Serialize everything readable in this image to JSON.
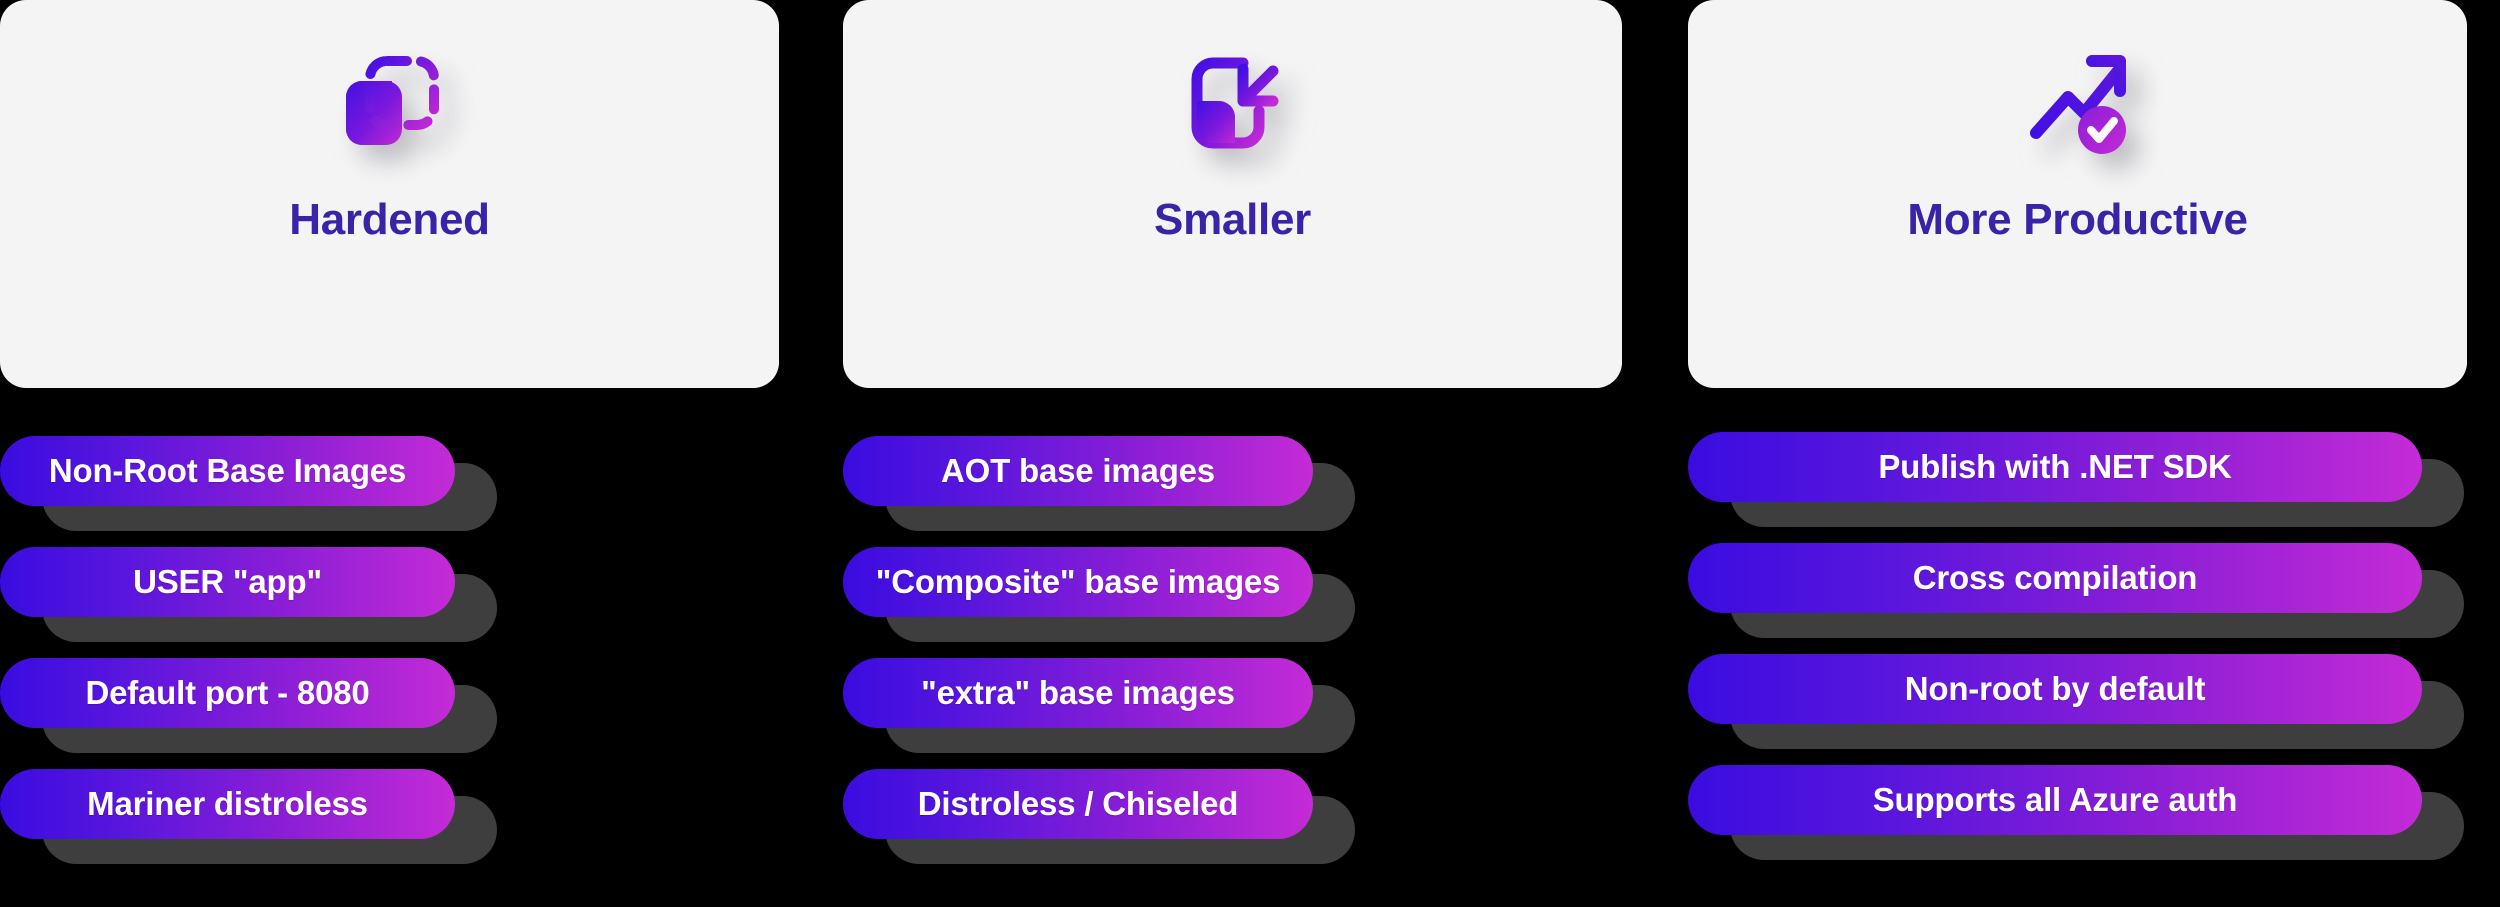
{
  "theme": {
    "background": "#000000",
    "card_background": "#f4f4f5",
    "card_shadow": "#b2b2b2",
    "title_color": "#3a23a8",
    "pill_gradient_start": "#3a0ce0",
    "pill_gradient_end": "#c42bd6",
    "pill_shadow": "#3e3e3e",
    "pill_label_color": "#ffffff",
    "icon_gradient_start": "#4310e3",
    "icon_gradient_end": "#c32ad4"
  },
  "columns": [
    {
      "id": "hardened",
      "title": "Hardened",
      "icon": "overlapping-squares-icon",
      "items": [
        {
          "label": "Non-Root Base Images"
        },
        {
          "label": "USER \"app\""
        },
        {
          "label": "Default port - 8080"
        },
        {
          "label": "Mariner distroless"
        }
      ]
    },
    {
      "id": "smaller",
      "title": "Smaller",
      "icon": "shrink-arrow-icon",
      "items": [
        {
          "label": "AOT base images"
        },
        {
          "label": "\"Composite\" base images"
        },
        {
          "label": "\"extra\" base images"
        },
        {
          "label": "Distroless / Chiseled"
        }
      ]
    },
    {
      "id": "more-productive",
      "title": "More Productive",
      "icon": "trending-up-check-icon",
      "items": [
        {
          "label": "Publish with .NET SDK"
        },
        {
          "label": "Cross compilation"
        },
        {
          "label": "Non-root by default"
        },
        {
          "label": "Supports all Azure auth"
        }
      ]
    }
  ]
}
